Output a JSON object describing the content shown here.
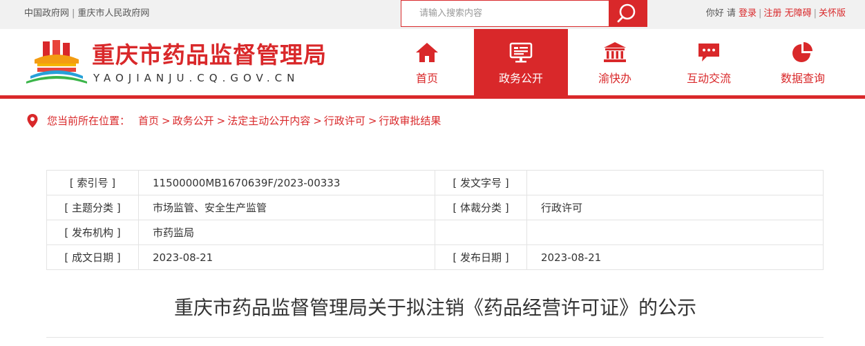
{
  "topbar": {
    "links": [
      "中国政府网",
      "重庆市人民政府网"
    ],
    "separator": "|",
    "search_placeholder": "请输入搜索内容",
    "greeting": "你好",
    "please": "请",
    "login": "登录",
    "register": "注册",
    "accessible": "无障碍",
    "care_version": "关怀版"
  },
  "header": {
    "site_name": "重庆市药品监督管理局",
    "domain": "YAOJIANJU.CQ.GOV.CN",
    "nav": [
      {
        "label": "首页",
        "icon": "home-icon",
        "active": false
      },
      {
        "label": "政务公开",
        "icon": "monitor-icon",
        "active": true
      },
      {
        "label": "渝快办",
        "icon": "government-building-icon",
        "active": false
      },
      {
        "label": "互动交流",
        "icon": "chat-bubble-icon",
        "active": false
      },
      {
        "label": "数据查询",
        "icon": "pie-chart-icon",
        "active": false
      }
    ]
  },
  "breadcrumb": {
    "label": "您当前所在位置：",
    "items": [
      "首页",
      "政务公开",
      "法定主动公开内容",
      "行政许可",
      "行政审批结果"
    ],
    "arrow": ">"
  },
  "meta": {
    "rows": [
      [
        "[ 索引号 ]",
        "11500000MB1670639F/2023-00333",
        "[ 发文字号 ]",
        ""
      ],
      [
        "[ 主题分类 ]",
        "市场监管、安全生产监管",
        "[ 体裁分类 ]",
        "行政许可"
      ],
      [
        "[ 发布机构 ]",
        "市药监局",
        "",
        ""
      ],
      [
        "[ 成文日期 ]",
        "2023-08-21",
        "[ 发布日期 ]",
        "2023-08-21"
      ]
    ]
  },
  "article": {
    "title": "重庆市药品监督管理局关于拟注销《药品经营许可证》的公示"
  },
  "colors": {
    "brand_red": "#d9282a",
    "topbar_bg": "#f1f1f1",
    "border": "#e3e3e3"
  }
}
